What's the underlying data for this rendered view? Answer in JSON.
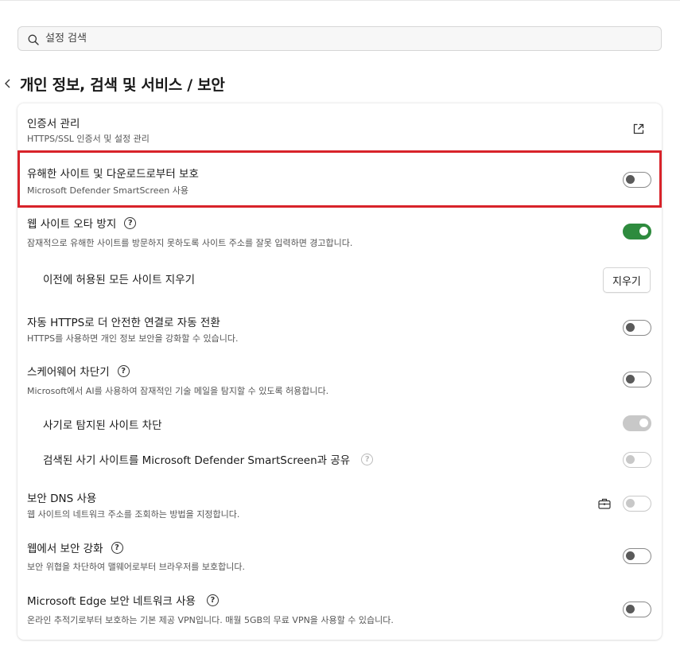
{
  "search": {
    "placeholder": "설정 검색",
    "icon": "search-icon"
  },
  "header": {
    "back_icon": "chevron-left-icon",
    "title": "개인 정보, 검색 및 서비스 / 보안"
  },
  "settings": {
    "cert": {
      "title": "인증서 관리",
      "desc": "HTTPS/SSL 인증서 및 설정 관리",
      "icon": "external-link-icon"
    },
    "smartscreen": {
      "title": "유해한 사이트 및 다운로드로부터 보호",
      "desc": "Microsoft Defender SmartScreen 사용",
      "enabled": false
    },
    "typo": {
      "title": "웹 사이트 오타 방지",
      "desc": "잠재적으로 유해한 사이트를 방문하지 못하도록 사이트 주소를 잘못 입력하면 경고합니다.",
      "enabled": true,
      "help": "?"
    },
    "clear_allowed": {
      "title": "이전에 허용된 모든 사이트 지우기",
      "button": "지우기"
    },
    "https": {
      "title": "자동 HTTPS로 더 안전한 연결로 자동 전환",
      "desc": "HTTPS를 사용하면 개인 정보 보안을 강화할 수 있습니다.",
      "enabled": false
    },
    "scareware": {
      "title": "스케어웨어 차단기",
      "desc": "Microsoft에서 AI를 사용하여 잠재적인 기술 메일을 탐지할 수 있도록 허용합니다.",
      "enabled": false,
      "help": "?"
    },
    "fraud_block": {
      "title": "사기로 탐지된 사이트 차단",
      "enabled": true,
      "disabled": true
    },
    "fraud_share": {
      "title": "검색된 사기 사이트를 Microsoft Defender SmartScreen과 공유",
      "enabled": false,
      "disabled": true,
      "help": "?"
    },
    "dns": {
      "title": "보안 DNS 사용",
      "desc": "웹 사이트의 네트워크 주소를 조회하는 방법을 지정합니다.",
      "enabled": false,
      "disabled": true,
      "icon": "briefcase-icon"
    },
    "enhance": {
      "title": "웹에서 보안 강화",
      "desc": "보안 위협을 차단하여 맬웨어로부터 브라우저를 보호합니다.",
      "enabled": false,
      "help": "?"
    },
    "vpn": {
      "title": "Microsoft Edge 보안 네트워크 사용",
      "desc": "온라인 추적기로부터 보호하는 기본 제공 VPN입니다. 매월 5GB의 무료 VPN을 사용할 수 있습니다.",
      "enabled": false,
      "help": "?"
    }
  },
  "colors": {
    "toggle_on": "#2e8b3e",
    "highlight": "#d8232a"
  }
}
